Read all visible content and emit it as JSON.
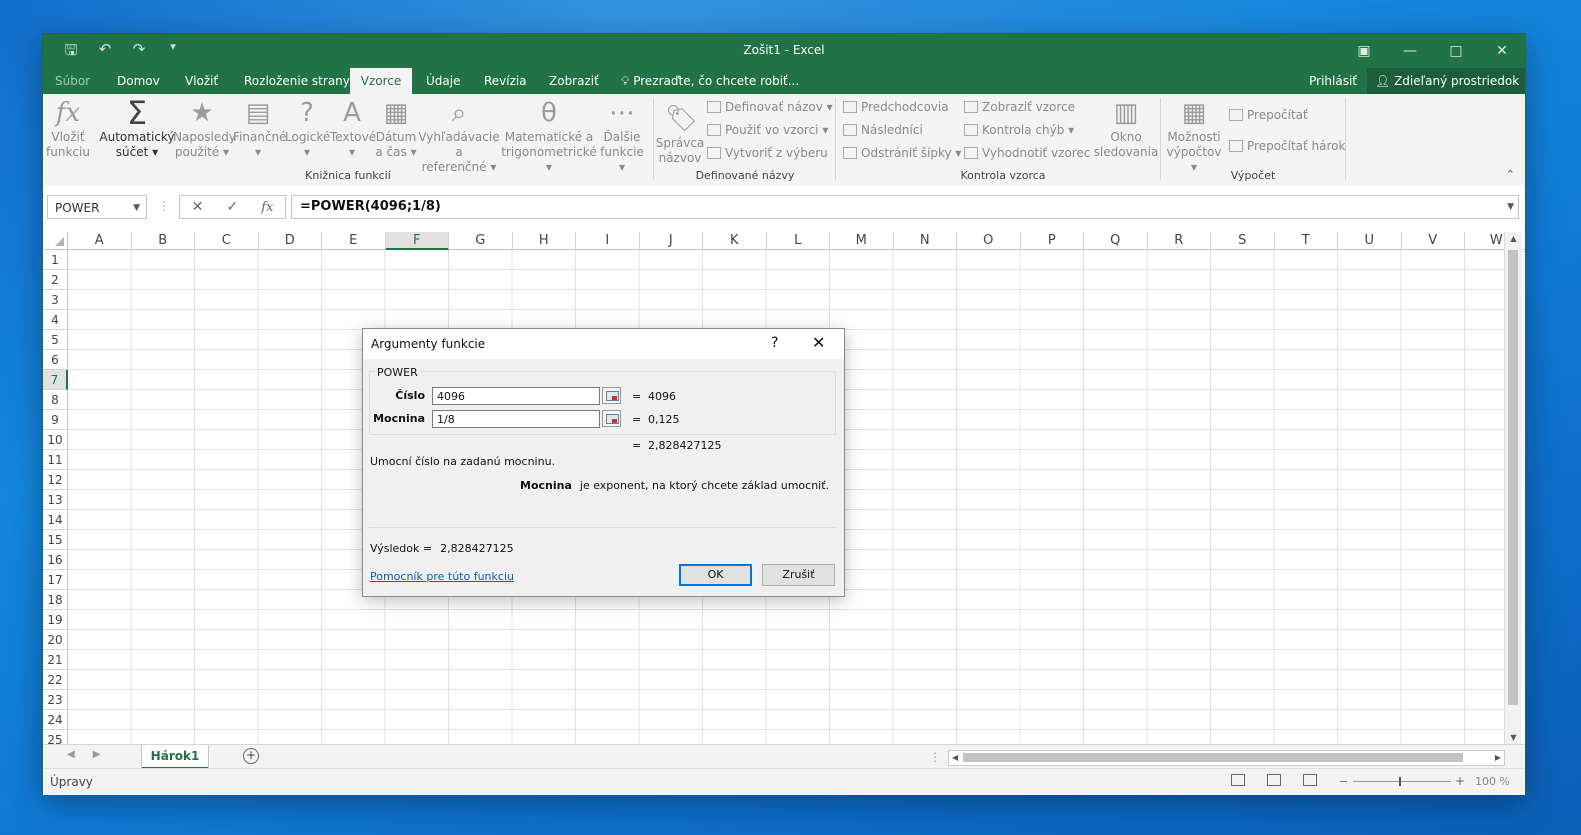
{
  "window": {
    "title": "Zošit1 - Excel"
  },
  "tabs": [
    "Súbor",
    "Domov",
    "Vložiť",
    "Rozloženie strany",
    "Vzorce",
    "Údaje",
    "Revízia",
    "Zobraziť"
  ],
  "tell_me": "Prezraďte, čo chcete robiť...",
  "signin": "Prihlásiť",
  "share": "Zdieľaný prostriedok",
  "ribbon": {
    "lib": {
      "insert_fn": [
        "Vložiť",
        "funkciu"
      ],
      "autosum": [
        "Automatický",
        "súčet"
      ],
      "recent": [
        "Naposledy",
        "použité"
      ],
      "financial": [
        "Finančné",
        ""
      ],
      "logical": [
        "Logické",
        ""
      ],
      "text": [
        "Textové",
        ""
      ],
      "datetime": [
        "Dátum",
        "a čas"
      ],
      "lookup": [
        "Vyhľadávacie a",
        "referenčné"
      ],
      "math": [
        "Matematické a",
        "trigonometrické"
      ],
      "more": [
        "Ďalšie",
        "funkcie"
      ],
      "label": "Knižnica funkcií"
    },
    "names": {
      "manager": [
        "Správca",
        "názvov"
      ],
      "define": "Definovať názov",
      "use": "Použiť vo vzorci",
      "create": "Vytvoriť z výberu",
      "label": "Definované názvy"
    },
    "audit": {
      "precedents": "Predchodcovia",
      "dependents": "Následníci",
      "remove": "Odstrániť šípky",
      "show": "Zobraziť vzorce",
      "check": "Kontrola chýb",
      "evaluate": "Vyhodnotiť vzorec",
      "watch": [
        "Okno",
        "sledovania"
      ],
      "label": "Kontrola vzorca"
    },
    "calc": {
      "options": [
        "Možnosti",
        "výpočtov"
      ],
      "now": "Prepočítať",
      "sheet": "Prepočítať hárok",
      "label": "Výpočet"
    }
  },
  "formula_bar": {
    "name_box": "POWER",
    "formula": "=POWER(4096;1/8)",
    "fx": "fx"
  },
  "grid": {
    "columns": [
      "A",
      "B",
      "C",
      "D",
      "E",
      "F",
      "G",
      "H",
      "I",
      "J",
      "K",
      "L",
      "M",
      "N",
      "O",
      "P",
      "Q",
      "R",
      "S",
      "T",
      "U",
      "V",
      "W"
    ],
    "rows": [
      "1",
      "2",
      "3",
      "4",
      "5",
      "6",
      "7",
      "8",
      "9",
      "10",
      "11",
      "12",
      "13",
      "14",
      "15",
      "16",
      "17",
      "18",
      "19",
      "20",
      "21",
      "22",
      "23",
      "24",
      "25"
    ],
    "selected_column": "F",
    "selected_row": "7"
  },
  "sheet_tab": "Hárok1",
  "status": {
    "mode": "Úpravy",
    "zoom": "100 %"
  },
  "dialog": {
    "title": "Argumenty funkcie",
    "help": "?",
    "function": "POWER",
    "arg1": {
      "label": "Číslo",
      "value": "4096",
      "result": "4096"
    },
    "arg2": {
      "label": "Mocnina",
      "value": "1/8",
      "result": "0,125"
    },
    "eq": "=",
    "formula_result": "2,828427125",
    "description": "Umocní číslo na zadanú mocninu.",
    "arg_help_name": "Mocnina",
    "arg_help_text": "je exponent, na ktorý chcete základ umocniť.",
    "result_label": "Výsledok =",
    "result_value": "2,828427125",
    "help_link": "Pomocník pre túto funkciu",
    "ok": "OK",
    "cancel": "Zrušiť"
  }
}
